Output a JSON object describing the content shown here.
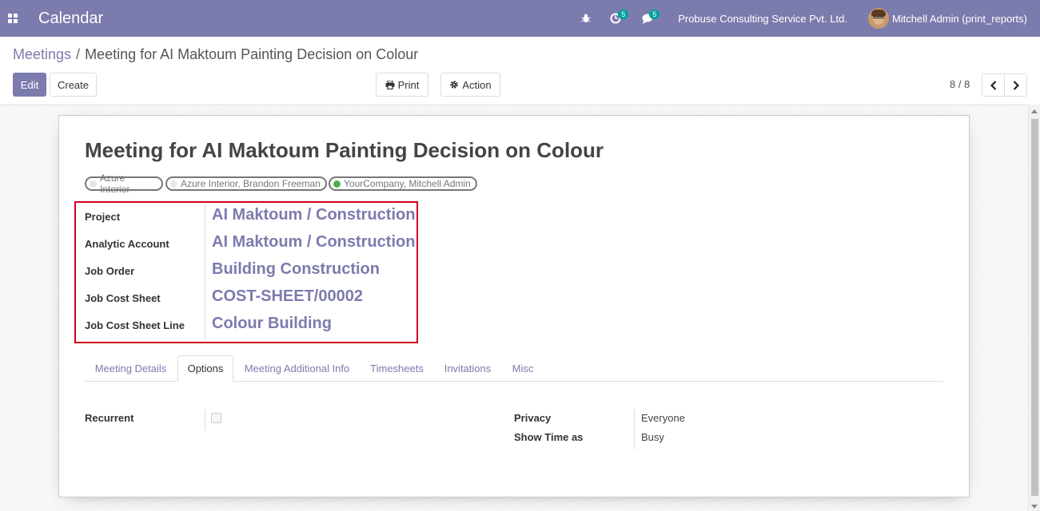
{
  "navbar": {
    "app_title": "Calendar",
    "activity_badge": "5",
    "messages_badge": "5",
    "company": "Probuse Consulting Service Pvt. Ltd.",
    "user": "Mitchell Admin (print_reports)",
    "color": "#7c7bad"
  },
  "breadcrumb": {
    "parent": "Meetings",
    "separator": "/",
    "current": "Meeting for AI Maktoum Painting Decision on Colour"
  },
  "buttons": {
    "edit": "Edit",
    "create": "Create",
    "print": "Print",
    "action": "Action"
  },
  "pager": {
    "value": "8 / 8"
  },
  "record": {
    "title": "Meeting for AI Maktoum Painting Decision on Colour",
    "attendees": [
      {
        "label": "Azure Interior",
        "status": "none"
      },
      {
        "label": "Azure Interior, Brandon Freeman",
        "status": "none"
      },
      {
        "label": "YourCompany, Mitchell Admin",
        "status": "accepted"
      }
    ],
    "fields": [
      {
        "label": "Project",
        "value": "AI Maktoum / Construction"
      },
      {
        "label": "Analytic Account",
        "value": "AI Maktoum / Construction"
      },
      {
        "label": "Job Order",
        "value": "Building Construction"
      },
      {
        "label": "Job Cost Sheet",
        "value": "COST-SHEET/00002"
      },
      {
        "label": "Job Cost Sheet Line",
        "value": "Colour Building"
      }
    ]
  },
  "tabs": [
    {
      "label": "Meeting Details",
      "active": false
    },
    {
      "label": "Options",
      "active": true
    },
    {
      "label": "Meeting Additional Info",
      "active": false
    },
    {
      "label": "Timesheets",
      "active": false
    },
    {
      "label": "Invitations",
      "active": false
    },
    {
      "label": "Misc",
      "active": false
    }
  ],
  "options": {
    "recurrent_label": "Recurrent",
    "recurrent_checked": false,
    "privacy_label": "Privacy",
    "privacy_value": "Everyone",
    "show_time_label": "Show Time as",
    "show_time_value": "Busy"
  }
}
